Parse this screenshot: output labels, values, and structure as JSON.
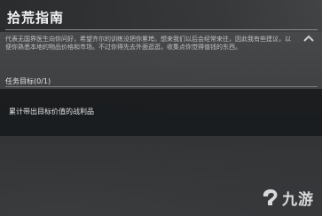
{
  "header": {
    "title": "拾荒指南"
  },
  "description": "代表无国界医生向你问好，希望齐尔的训练没把你累垮。想来我们以后会经常来往，因此我有些建议，以便你熟悉本地的物品价格和市场。不过你得先去外面逛逛，收集点你觉得值钱的东西。",
  "tasks": {
    "label": "任务目标(0/1)",
    "items": [
      {
        "text": "累计带出目标价值的战利品"
      }
    ]
  },
  "icons": {
    "collapse": "chevron-up-icon",
    "logo": "jiuyou-logo-icon"
  },
  "watermark": {
    "text": "九游"
  },
  "colors": {
    "panel_dark": "#181a1c",
    "text_light": "#e4e4e4",
    "divider": "#7a7c7e"
  }
}
